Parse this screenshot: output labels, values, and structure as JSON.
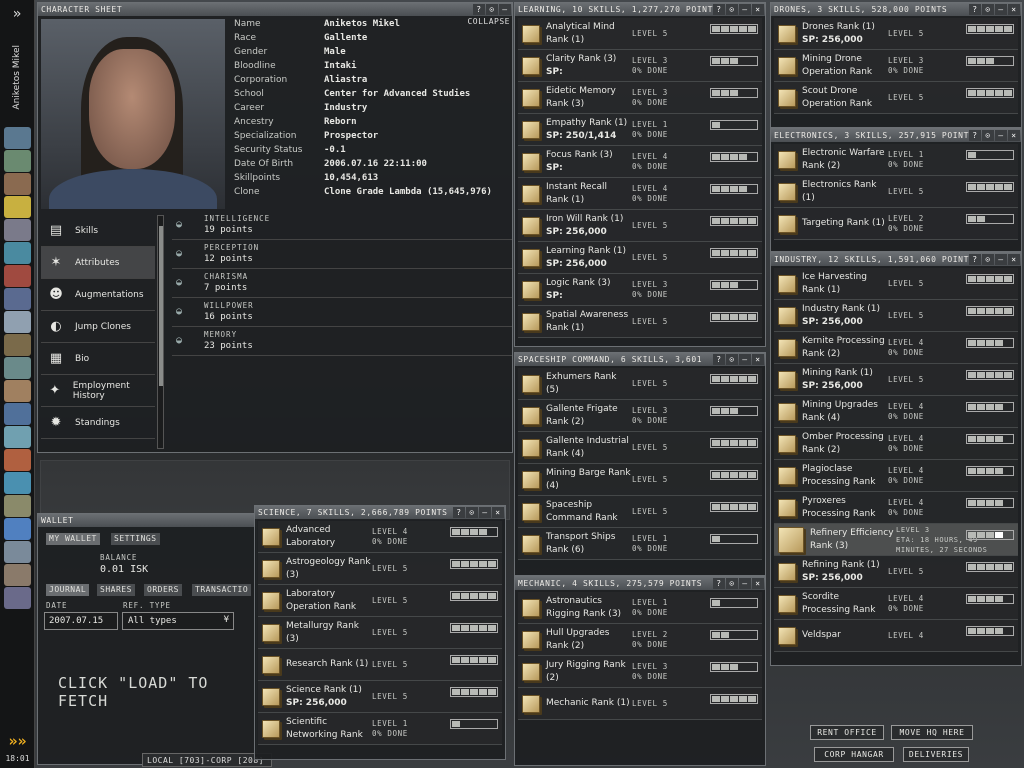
{
  "sidebar": {
    "character_name": "Aniketos Mikel",
    "clock": "18:01",
    "expand": "»",
    "chevrons": "»»"
  },
  "character_sheet": {
    "title": "CHARACTER SHEET",
    "collapse": "COLLAPSE",
    "info": [
      {
        "label": "Name",
        "value": "Aniketos Mikel"
      },
      {
        "label": "Race",
        "value": "Gallente"
      },
      {
        "label": "Gender",
        "value": "Male"
      },
      {
        "label": "Bloodline",
        "value": "Intaki"
      },
      {
        "label": "Corporation",
        "value": "Aliastra"
      },
      {
        "label": "School",
        "value": "Center for Advanced Studies"
      },
      {
        "label": "Career",
        "value": "Industry"
      },
      {
        "label": "Ancestry",
        "value": "Reborn"
      },
      {
        "label": "Specialization",
        "value": "Prospector"
      },
      {
        "label": "Security Status",
        "value": "-0.1"
      },
      {
        "label": "Date Of Birth",
        "value": "2006.07.16 22:11:00"
      },
      {
        "label": "Skillpoints",
        "value": "10,454,613"
      },
      {
        "label": "Clone",
        "value": "Clone Grade Lambda (15,645,976)"
      }
    ],
    "tabs": [
      {
        "label": "Skills",
        "icon": "book-icon"
      },
      {
        "label": "Attributes",
        "icon": "attributes-icon"
      },
      {
        "label": "Augmentations",
        "icon": "augmentations-icon"
      },
      {
        "label": "Jump Clones",
        "icon": "jump-clones-icon"
      },
      {
        "label": "Bio",
        "icon": "bio-icon"
      },
      {
        "label": "Employment History",
        "icon": "employment-icon"
      },
      {
        "label": "Standings",
        "icon": "standings-icon"
      }
    ],
    "attributes": [
      {
        "name": "INTELLIGENCE",
        "points": "19 points"
      },
      {
        "name": "PERCEPTION",
        "points": "12 points"
      },
      {
        "name": "CHARISMA",
        "points": "7 points"
      },
      {
        "name": "WILLPOWER",
        "points": "16 points"
      },
      {
        "name": "MEMORY",
        "points": "23 points"
      }
    ]
  },
  "wallet": {
    "title": "WALLET",
    "tabs": [
      "MY WALLET",
      "SETTINGS"
    ],
    "balance_label": "BALANCE",
    "balance": "0.01 ISK",
    "subtabs": [
      "JOURNAL",
      "SHARES",
      "ORDERS",
      "TRANSACTIO"
    ],
    "date_label": "DATE",
    "ref_label": "REF. TYPE",
    "date": "2007.07.15",
    "ref_type": "All types",
    "hint": "CLICK \"LOAD\" TO FETCH",
    "local": "LOCAL [703]-CORP [208]"
  },
  "skill_groups": {
    "learning": {
      "title": "LEARNING, 10 SKILLS, 1,277,270 POINTS",
      "skills": [
        {
          "name": "Analytical Mind Rank (1)",
          "level": "LEVEL 5",
          "pct": "",
          "lv": 5
        },
        {
          "name": "Clarity Rank (3)",
          "sp": "SP:",
          "level": "LEVEL 3",
          "pct": "0% DONE",
          "lv": 3
        },
        {
          "name": "Eidetic Memory Rank (3)",
          "level": "LEVEL 3",
          "pct": "0% DONE",
          "lv": 3
        },
        {
          "name": "Empathy Rank (1)",
          "sp": "SP: 250/1,414",
          "level": "LEVEL 1",
          "pct": "0% DONE",
          "lv": 1
        },
        {
          "name": "Focus Rank (3)",
          "sp": "SP:",
          "level": "LEVEL 4",
          "pct": "0% DONE",
          "lv": 4
        },
        {
          "name": "Instant Recall Rank (1)",
          "level": "LEVEL 4",
          "pct": "0% DONE",
          "lv": 4
        },
        {
          "name": "Iron Will Rank (1)",
          "sp": "SP: 256,000",
          "level": "LEVEL 5",
          "pct": "",
          "lv": 5
        },
        {
          "name": "Learning Rank (1)",
          "sp": "SP: 256,000",
          "level": "LEVEL 5",
          "pct": "",
          "lv": 5
        },
        {
          "name": "Logic Rank (3)",
          "sp": "SP:",
          "level": "LEVEL 3",
          "pct": "0% DONE",
          "lv": 3
        },
        {
          "name": "Spatial Awareness Rank (1)",
          "level": "LEVEL 5",
          "pct": "",
          "lv": 5
        }
      ]
    },
    "spaceship": {
      "title": "SPACESHIP COMMAND, 6 SKILLS, 3,601",
      "skills": [
        {
          "name": "Exhumers Rank (5)",
          "level": "LEVEL 5",
          "pct": "",
          "lv": 5
        },
        {
          "name": "Gallente Frigate Rank (2)",
          "level": "LEVEL 3",
          "pct": "0% DONE",
          "lv": 3
        },
        {
          "name": "Gallente Industrial Rank (4)",
          "level": "LEVEL 5",
          "pct": "",
          "lv": 5
        },
        {
          "name": "Mining Barge Rank (4)",
          "level": "LEVEL 5",
          "pct": "",
          "lv": 5
        },
        {
          "name": "Spaceship Command Rank",
          "level": "LEVEL 5",
          "pct": "",
          "lv": 5
        },
        {
          "name": "Transport Ships Rank (6)",
          "level": "LEVEL 1",
          "pct": "0% DONE",
          "lv": 1
        }
      ]
    },
    "mechanic": {
      "title": "MECHANIC, 4 SKILLS, 275,579 POINTS",
      "skills": [
        {
          "name": "Astronautics Rigging Rank (3)",
          "level": "LEVEL 1",
          "pct": "0% DONE",
          "lv": 1
        },
        {
          "name": "Hull Upgrades Rank (2)",
          "level": "LEVEL 2",
          "pct": "0% DONE",
          "lv": 2
        },
        {
          "name": "Jury Rigging Rank (2)",
          "level": "LEVEL 3",
          "pct": "0% DONE",
          "lv": 3
        },
        {
          "name": "Mechanic Rank (1)",
          "level": "LEVEL 5",
          "pct": "",
          "lv": 5
        }
      ]
    },
    "science": {
      "title": "SCIENCE, 7 SKILLS, 2,666,789 POINTS",
      "skills": [
        {
          "name": "Advanced Laboratory",
          "level": "LEVEL 4",
          "pct": "0% DONE",
          "lv": 4
        },
        {
          "name": "Astrogeology Rank (3)",
          "level": "LEVEL 5",
          "pct": "",
          "lv": 5
        },
        {
          "name": "Laboratory Operation Rank",
          "level": "LEVEL 5",
          "pct": "",
          "lv": 5
        },
        {
          "name": "Metallurgy Rank (3)",
          "level": "LEVEL 5",
          "pct": "",
          "lv": 5
        },
        {
          "name": "Research Rank (1)",
          "level": "LEVEL 5",
          "pct": "",
          "lv": 5
        },
        {
          "name": "Science Rank (1)",
          "sp": "SP: 256,000",
          "level": "LEVEL 5",
          "pct": "",
          "lv": 5
        },
        {
          "name": "Scientific Networking Rank",
          "level": "LEVEL 1",
          "pct": "0% DONE",
          "lv": 1
        }
      ]
    },
    "drones": {
      "title": "DRONES, 3 SKILLS, 528,000 POINTS",
      "skills": [
        {
          "name": "Drones Rank (1)",
          "sp": "SP: 256,000",
          "level": "LEVEL 5",
          "pct": "",
          "lv": 5
        },
        {
          "name": "Mining Drone Operation Rank",
          "level": "LEVEL 3",
          "pct": "0% DONE",
          "lv": 3
        },
        {
          "name": "Scout Drone Operation Rank",
          "level": "LEVEL 5",
          "pct": "",
          "lv": 5
        }
      ]
    },
    "electronics": {
      "title": "ELECTRONICS, 3 SKILLS, 257,915 POINTS",
      "skills": [
        {
          "name": "Electronic Warfare Rank (2)",
          "level": "LEVEL 1",
          "pct": "0% DONE",
          "lv": 1
        },
        {
          "name": "Electronics Rank (1)",
          "level": "LEVEL 5",
          "pct": "",
          "lv": 5
        },
        {
          "name": "Targeting Rank (1)",
          "level": "LEVEL 2",
          "pct": "0% DONE",
          "lv": 2
        }
      ]
    },
    "industry": {
      "title": "INDUSTRY, 12 SKILLS, 1,591,060 POINTS",
      "skills": [
        {
          "name": "Ice Harvesting Rank (1)",
          "level": "LEVEL 5",
          "pct": "",
          "lv": 5
        },
        {
          "name": "Industry Rank (1)",
          "sp": "SP: 256,000",
          "level": "LEVEL 5",
          "pct": "",
          "lv": 5
        },
        {
          "name": "Kernite Processing Rank (2)",
          "level": "LEVEL 4",
          "pct": "0% DONE",
          "lv": 4
        },
        {
          "name": "Mining Rank (1)",
          "sp": "SP: 256,000",
          "level": "LEVEL 5",
          "pct": "",
          "lv": 5
        },
        {
          "name": "Mining Upgrades Rank (4)",
          "level": "LEVEL 4",
          "pct": "0% DONE",
          "lv": 4
        },
        {
          "name": "Omber Processing Rank (2)",
          "level": "LEVEL 4",
          "pct": "0% DONE",
          "lv": 4
        },
        {
          "name": "Plagioclase Processing Rank",
          "level": "LEVEL 4",
          "pct": "0% DONE",
          "lv": 4
        },
        {
          "name": "Pyroxeres Processing Rank",
          "level": "LEVEL 4",
          "pct": "0% DONE",
          "lv": 4
        },
        {
          "name": "Refinery Efficiency Rank (3)",
          "level": "LEVEL 3",
          "pct": "ETA: 18 HOURS, 49 MINUTES, 27 SECONDS",
          "lv": 3,
          "training": true
        },
        {
          "name": "Refining Rank (1)",
          "sp": "SP: 256,000",
          "level": "LEVEL 5",
          "pct": "",
          "lv": 5
        },
        {
          "name": "Scordite Processing Rank",
          "level": "LEVEL 4",
          "pct": "0% DONE",
          "lv": 4
        },
        {
          "name": "Veldspar",
          "level": "LEVEL 4",
          "pct": "",
          "lv": 4
        }
      ]
    }
  },
  "station": {
    "buttons": [
      "RENT OFFICE",
      "MOVE HQ HERE",
      "CORP HANGAR",
      "DELIVERIES"
    ]
  },
  "window_buttons": {
    "info": "?",
    "opt": "⊙",
    "min": "–",
    "close": "×"
  }
}
